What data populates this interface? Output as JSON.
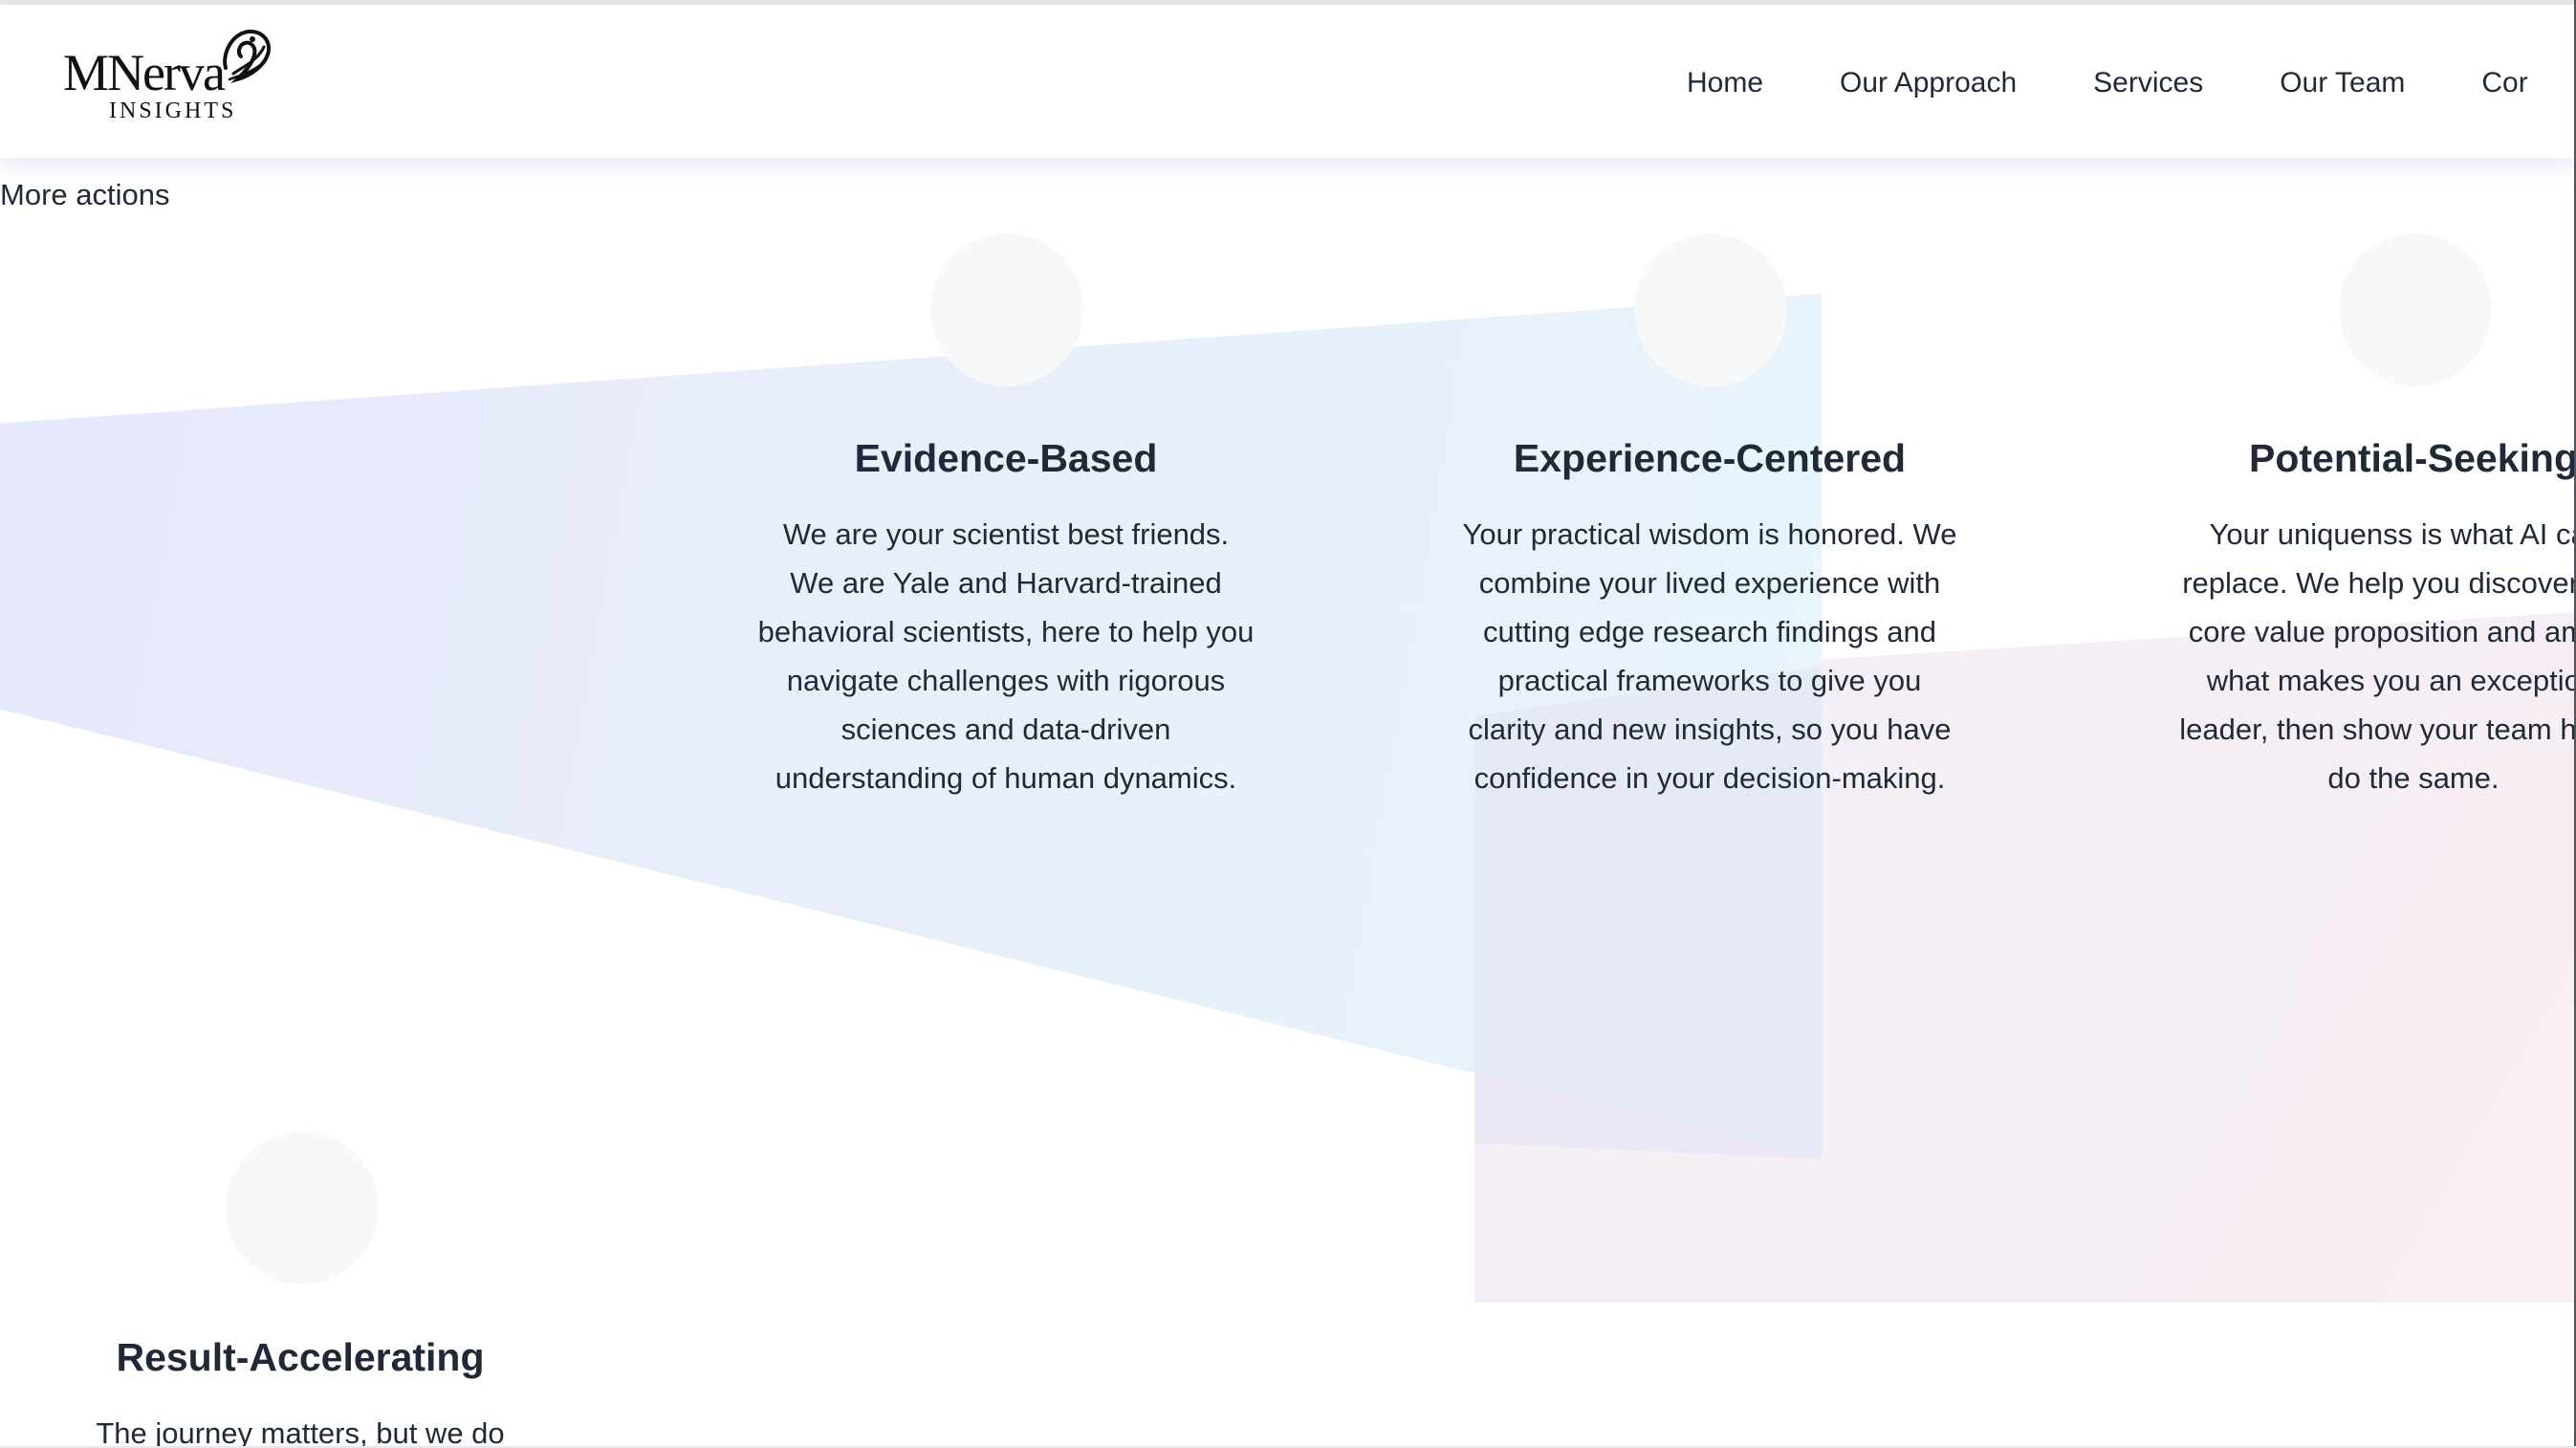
{
  "brand": {
    "name": "MNerva",
    "tagline": "INSIGHTS"
  },
  "nav": {
    "items": [
      {
        "label": "Home"
      },
      {
        "label": "Our Approach"
      },
      {
        "label": "Services"
      },
      {
        "label": "Our Team"
      },
      {
        "label": "Cor"
      }
    ]
  },
  "more_actions": "More actions",
  "cards": [
    {
      "title": "Evidence-Based",
      "body": "We are your scientist best friends. We are Yale and Harvard-trained behavioral scientists, here to help you navigate challenges with rigorous sciences and data-driven understanding of human dynamics."
    },
    {
      "title": "Experience-Centered",
      "body": "Your practical wisdom is honored. We combine your lived experience with cutting edge research findings and practical frameworks to give you clarity and new insights, so you have confidence in your decision-making."
    },
    {
      "title": "Potential-Seeking",
      "body": "Your uniquenss is what AI can't replace. We help you discover your core value proposition and amplify what makes you an exceptional leader, then show your team how to do the same."
    },
    {
      "title": "Result-Accelerating",
      "body": "The journey matters, but we do"
    }
  ],
  "colors": {
    "text": "#1f2937",
    "band_blue": "#e8eefb",
    "band_pink": "#f8eef4",
    "circle": "#f7f8fa"
  }
}
